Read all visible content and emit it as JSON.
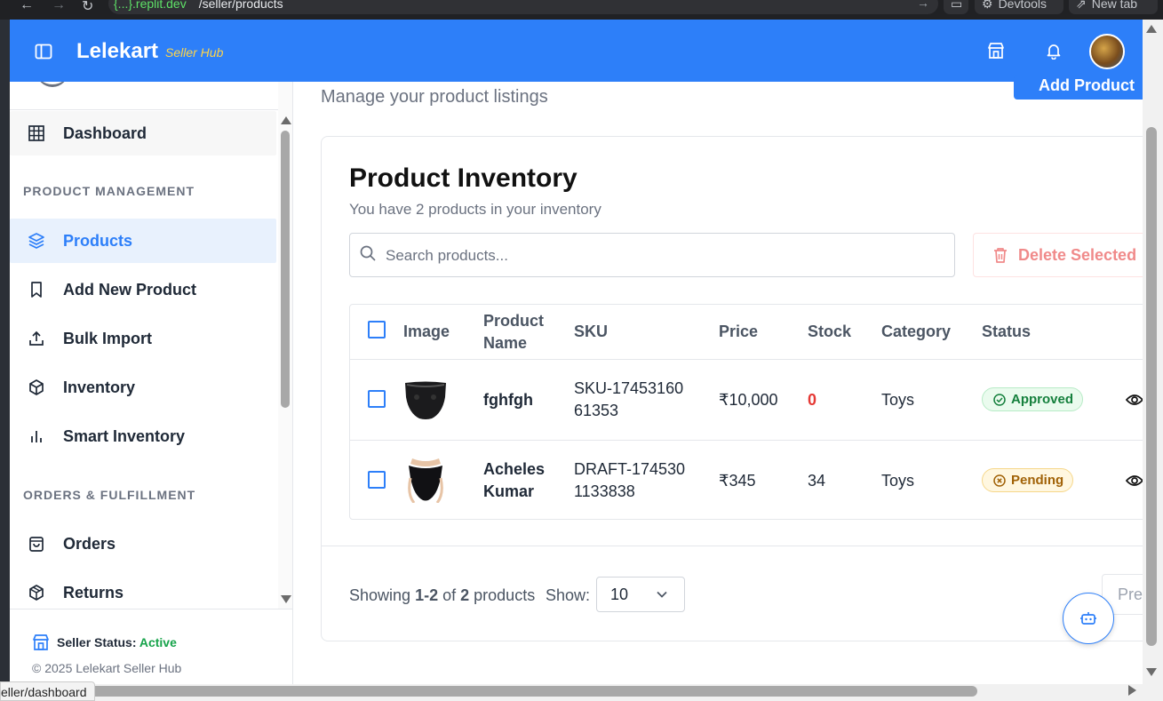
{
  "browser": {
    "url_host": "{...}.replit.dev",
    "url_path": "/seller/products",
    "devtools_label": "Devtools",
    "new_tab_label": "New tab",
    "status_url": "eller/dashboard"
  },
  "header": {
    "brand": "Lelekart",
    "brand_sub": "Seller Hub"
  },
  "sidebar": {
    "dashboard": "Dashboard",
    "section_product": "PRODUCT MANAGEMENT",
    "items_product": [
      "Products",
      "Add New Product",
      "Bulk Import",
      "Inventory",
      "Smart Inventory"
    ],
    "section_orders": "ORDERS & FULFILLMENT",
    "items_orders": [
      "Orders",
      "Returns"
    ],
    "seller_status_label": "Seller Status:",
    "seller_status_value": "Active",
    "copyright": "© 2025 Lelekart Seller Hub"
  },
  "page": {
    "subtitle": "Manage your product listings",
    "add_button": "Add Product"
  },
  "inventory": {
    "title": "Product Inventory",
    "subtitle": "You have 2 products in your inventory",
    "search_placeholder": "Search products...",
    "delete_selected": "Delete Selected",
    "columns": [
      "Image",
      "Product Name",
      "SKU",
      "Price",
      "Stock",
      "Category",
      "Status"
    ],
    "rows": [
      {
        "name": "fghfgh",
        "sku": "SKU-1745316061353",
        "price": "₹10,000",
        "stock": "0",
        "category": "Toys",
        "status": "Approved"
      },
      {
        "name": "Acheles Kumar",
        "sku": "DRAFT-1745301133838",
        "price": "₹345",
        "stock": "34",
        "category": "Toys",
        "status": "Pending"
      }
    ],
    "showing_prefix": "Showing",
    "showing_range": "1-2",
    "showing_of": "of",
    "showing_total": "2",
    "showing_suffix": "products",
    "show_label": "Show:",
    "page_size": "10",
    "prev_label": "Previous"
  },
  "colors": {
    "primary": "#2d7ff9",
    "accent_yellow": "#ffd54a",
    "danger": "#e53935",
    "success": "#15803d",
    "warning": "#a16207"
  }
}
